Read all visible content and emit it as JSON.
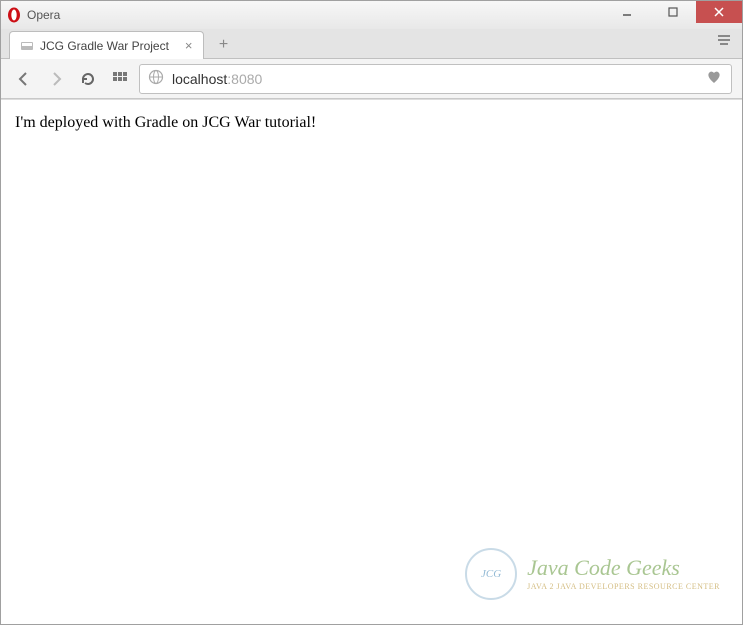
{
  "window": {
    "title": "Opera"
  },
  "tab": {
    "title": "JCG Gradle War Project"
  },
  "address": {
    "host": "localhost",
    "port": ":8080"
  },
  "page": {
    "body_text": "I'm deployed with Gradle on JCG War tutorial!"
  },
  "watermark": {
    "badge": "JCG",
    "title": "Java Code Geeks",
    "subtitle": "JAVA 2 JAVA DEVELOPERS RESOURCE CENTER"
  }
}
